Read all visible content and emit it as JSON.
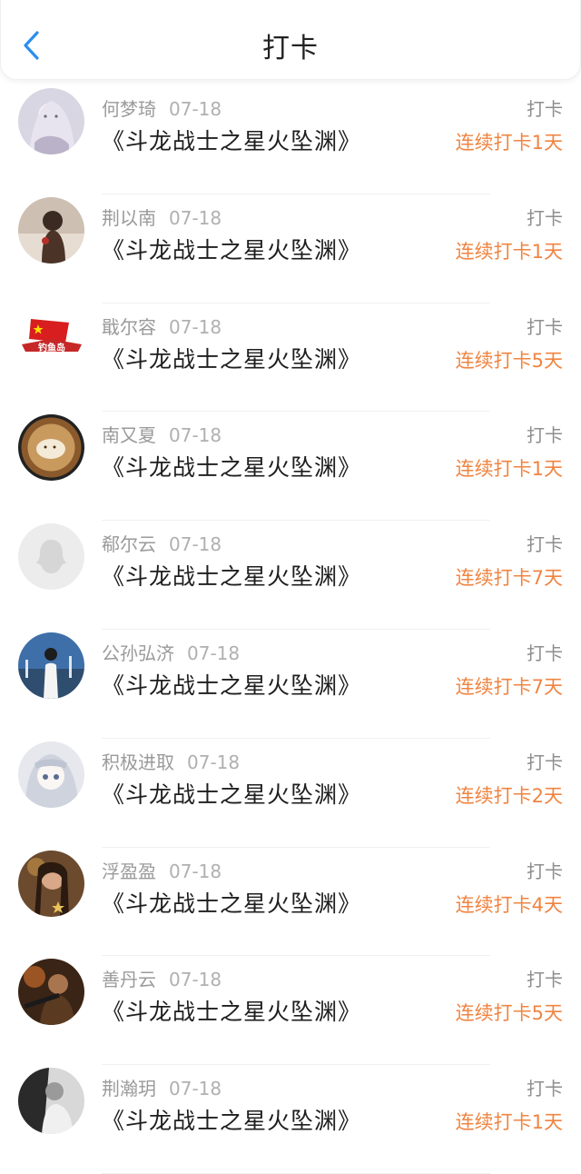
{
  "header": {
    "title": "打卡",
    "back_icon": "chevron-left-icon",
    "accent": "#2b8ef0"
  },
  "colors": {
    "streak": "#f08441",
    "name": "#9a9a9a"
  },
  "rows": [
    {
      "name": "何梦琦",
      "date": "07-18",
      "book": "《斗龙战士之星火坠渊》",
      "action": "打卡",
      "streak": "连续打卡1天"
    },
    {
      "name": "荆以南",
      "date": "07-18",
      "book": "《斗龙战士之星火坠渊》",
      "action": "打卡",
      "streak": "连续打卡1天"
    },
    {
      "name": "戢尔容",
      "date": "07-18",
      "book": "《斗龙战士之星火坠渊》",
      "action": "打卡",
      "streak": "连续打卡5天",
      "avatar_text": "钓鱼岛"
    },
    {
      "name": "南又夏",
      "date": "07-18",
      "book": "《斗龙战士之星火坠渊》",
      "action": "打卡",
      "streak": "连续打卡1天"
    },
    {
      "name": "郗尔云",
      "date": "07-18",
      "book": "《斗龙战士之星火坠渊》",
      "action": "打卡",
      "streak": "连续打卡7天"
    },
    {
      "name": "公孙弘济",
      "date": "07-18",
      "book": "《斗龙战士之星火坠渊》",
      "action": "打卡",
      "streak": "连续打卡7天"
    },
    {
      "name": "积极进取",
      "date": "07-18",
      "book": "《斗龙战士之星火坠渊》",
      "action": "打卡",
      "streak": "连续打卡2天"
    },
    {
      "name": "浮盈盈",
      "date": "07-18",
      "book": "《斗龙战士之星火坠渊》",
      "action": "打卡",
      "streak": "连续打卡4天"
    },
    {
      "name": "善丹云",
      "date": "07-18",
      "book": "《斗龙战士之星火坠渊》",
      "action": "打卡",
      "streak": "连续打卡5天"
    },
    {
      "name": "荆瀚玥",
      "date": "07-18",
      "book": "《斗龙战士之星火坠渊》",
      "action": "打卡",
      "streak": "连续打卡1天"
    }
  ]
}
